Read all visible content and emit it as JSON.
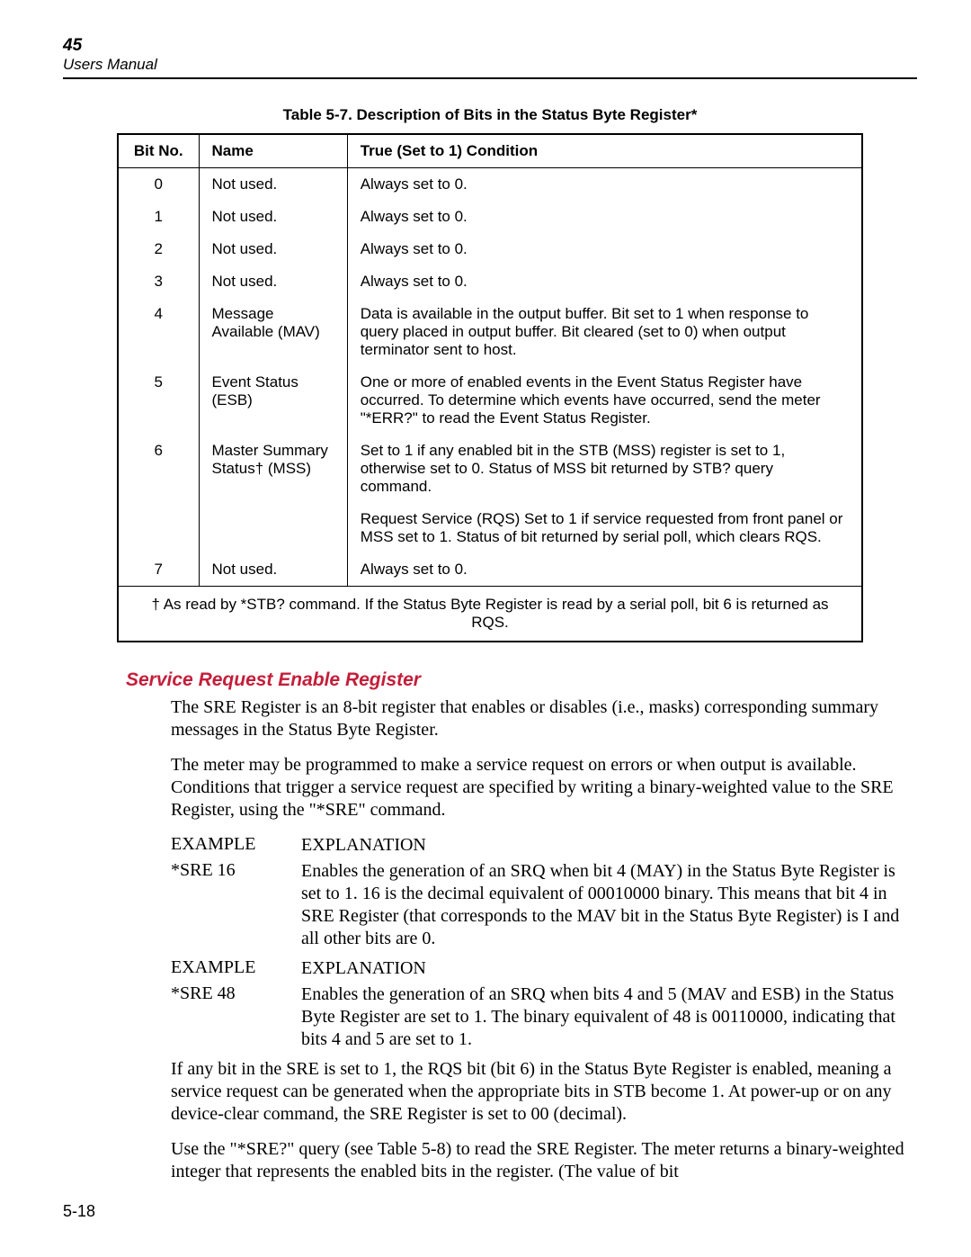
{
  "header": {
    "page_number": "45",
    "manual_title": "Users Manual"
  },
  "table_caption": "Table 5-7. Description of Bits in the Status Byte Register*",
  "table": {
    "headers": [
      "Bit No.",
      "Name",
      "True (Set to 1) Condition"
    ],
    "rows": [
      {
        "bit": "0",
        "name": "Not used.",
        "cond": "Always set to 0."
      },
      {
        "bit": "1",
        "name": "Not used.",
        "cond": "Always set to 0."
      },
      {
        "bit": "2",
        "name": "Not used.",
        "cond": "Always set to 0."
      },
      {
        "bit": "3",
        "name": "Not used.",
        "cond": "Always set to 0."
      },
      {
        "bit": "4",
        "name": "Message Available (MAV)",
        "cond": "Data is available in the output buffer. Bit set to 1 when response to query placed in output buffer. Bit cleared (set to 0) when output terminator sent to host."
      },
      {
        "bit": "5",
        "name": "Event Status (ESB)",
        "cond": "One or more of enabled events in the Event Status Register have occurred. To determine which events have occurred, send the meter \"*ERR?\" to read the Event Status Register."
      },
      {
        "bit": "6",
        "name": "Master Summary Status† (MSS)",
        "cond": "Set to 1 if any enabled bit in the STB (MSS) register is set to 1, otherwise set to 0. Status of MSS bit returned by STB? query command."
      },
      {
        "bit": "",
        "name": "",
        "cond": "Request Service (RQS) Set to 1 if service requested from front panel or MSS set to 1. Status of bit returned by serial poll, which clears RQS."
      },
      {
        "bit": "7",
        "name": "Not used.",
        "cond": "Always set to 0."
      }
    ],
    "footnote": "† As read by *STB? command. If the Status Byte Register is read by a serial poll, bit 6 is returned as RQS."
  },
  "section_heading": "Service Request Enable Register",
  "para1": "The SRE Register is an 8-bit register that enables or disables (i.e., masks) corresponding summary messages in the Status Byte Register.",
  "para2": "The meter may be programmed to make a service request on errors or when output is available. Conditions that trigger a service request are specified by writing a binary-weighted value to the SRE Register, using the \"*SRE\" command.",
  "ex1": {
    "h_left": "EXAMPLE",
    "h_right": "EXPLANATION",
    "cmd": "*SRE 16",
    "desc": "Enables the generation of an SRQ when bit 4 (MAY) in the Status Byte Register is set to 1. 16 is the decimal equivalent of 00010000 binary. This means that bit 4 in SRE Register (that corresponds to the MAV bit in the Status Byte Register) is I and all other bits are 0."
  },
  "ex2": {
    "h_left": "EXAMPLE",
    "h_right": "EXPLANATION",
    "cmd": "*SRE 48",
    "desc": "Enables the generation of an SRQ when bits 4 and 5 (MAV and ESB) in the Status Byte Register are set to 1. The binary equivalent of 48 is 00110000, indicating that bits 4 and 5 are set to 1."
  },
  "para3": "If any bit in the SRE is set to 1, the RQS bit (bit 6) in the Status Byte Register is enabled, meaning a service request can be generated when the appropriate bits in STB become 1. At power-up or on any device-clear command, the SRE Register is set to 00 (decimal).",
  "para4": "Use the \"*SRE?\" query (see Table 5-8) to read the SRE Register. The meter returns a binary-weighted integer that represents the enabled bits in the register.  (The value of bit",
  "footer_page": "5-18"
}
